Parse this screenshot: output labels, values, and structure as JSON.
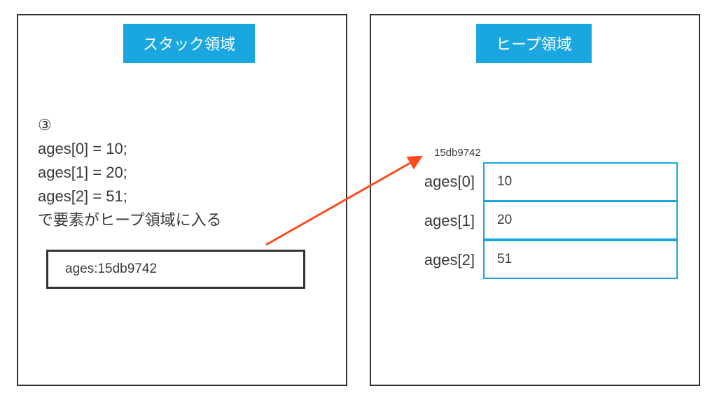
{
  "stack": {
    "title": "スタック領域",
    "step_marker": "③",
    "code_lines": [
      "ages[0] = 10;",
      "ages[1] = 20;",
      "ages[2] = 51;",
      "で要素がヒープ領域に入る"
    ],
    "variable": "ages:15db9742"
  },
  "heap": {
    "title": "ヒープ領域",
    "address": "15db9742",
    "rows": [
      {
        "label": "ages[0]",
        "value": "10"
      },
      {
        "label": "ages[1]",
        "value": "20"
      },
      {
        "label": "ages[2]",
        "value": "51"
      }
    ]
  },
  "arrow": {
    "color": "#ff4a1c"
  },
  "colors": {
    "accent": "#1aa7e0",
    "border": "#333333",
    "text": "#3a3a3a"
  }
}
